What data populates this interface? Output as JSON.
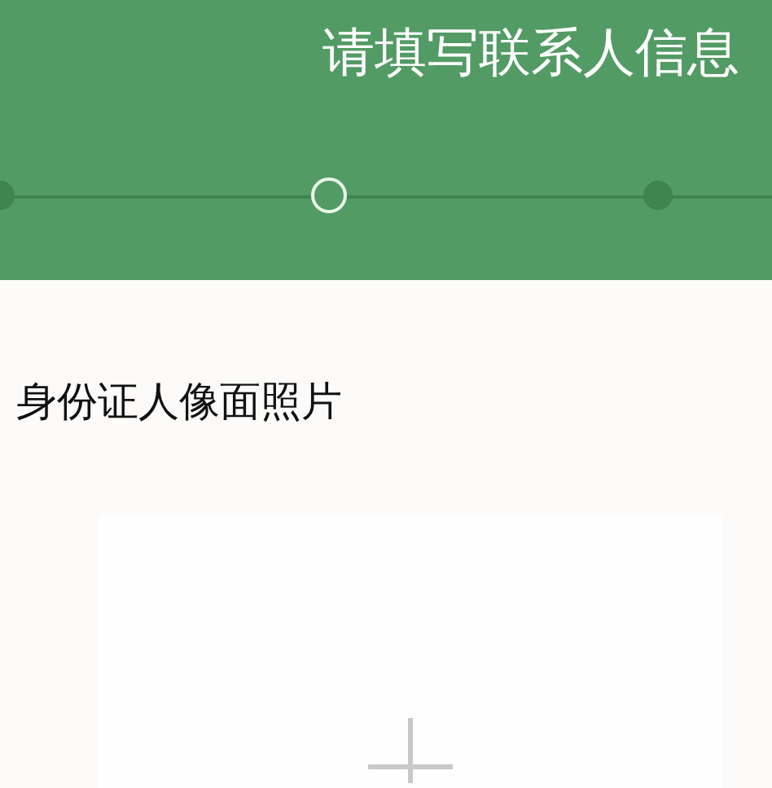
{
  "header": {
    "title": "请填写联系人信息"
  },
  "steps": [
    {
      "selected": false
    },
    {
      "selected": true
    },
    {
      "selected": false
    }
  ],
  "upload": {
    "label": "身份证人像面照片"
  }
}
